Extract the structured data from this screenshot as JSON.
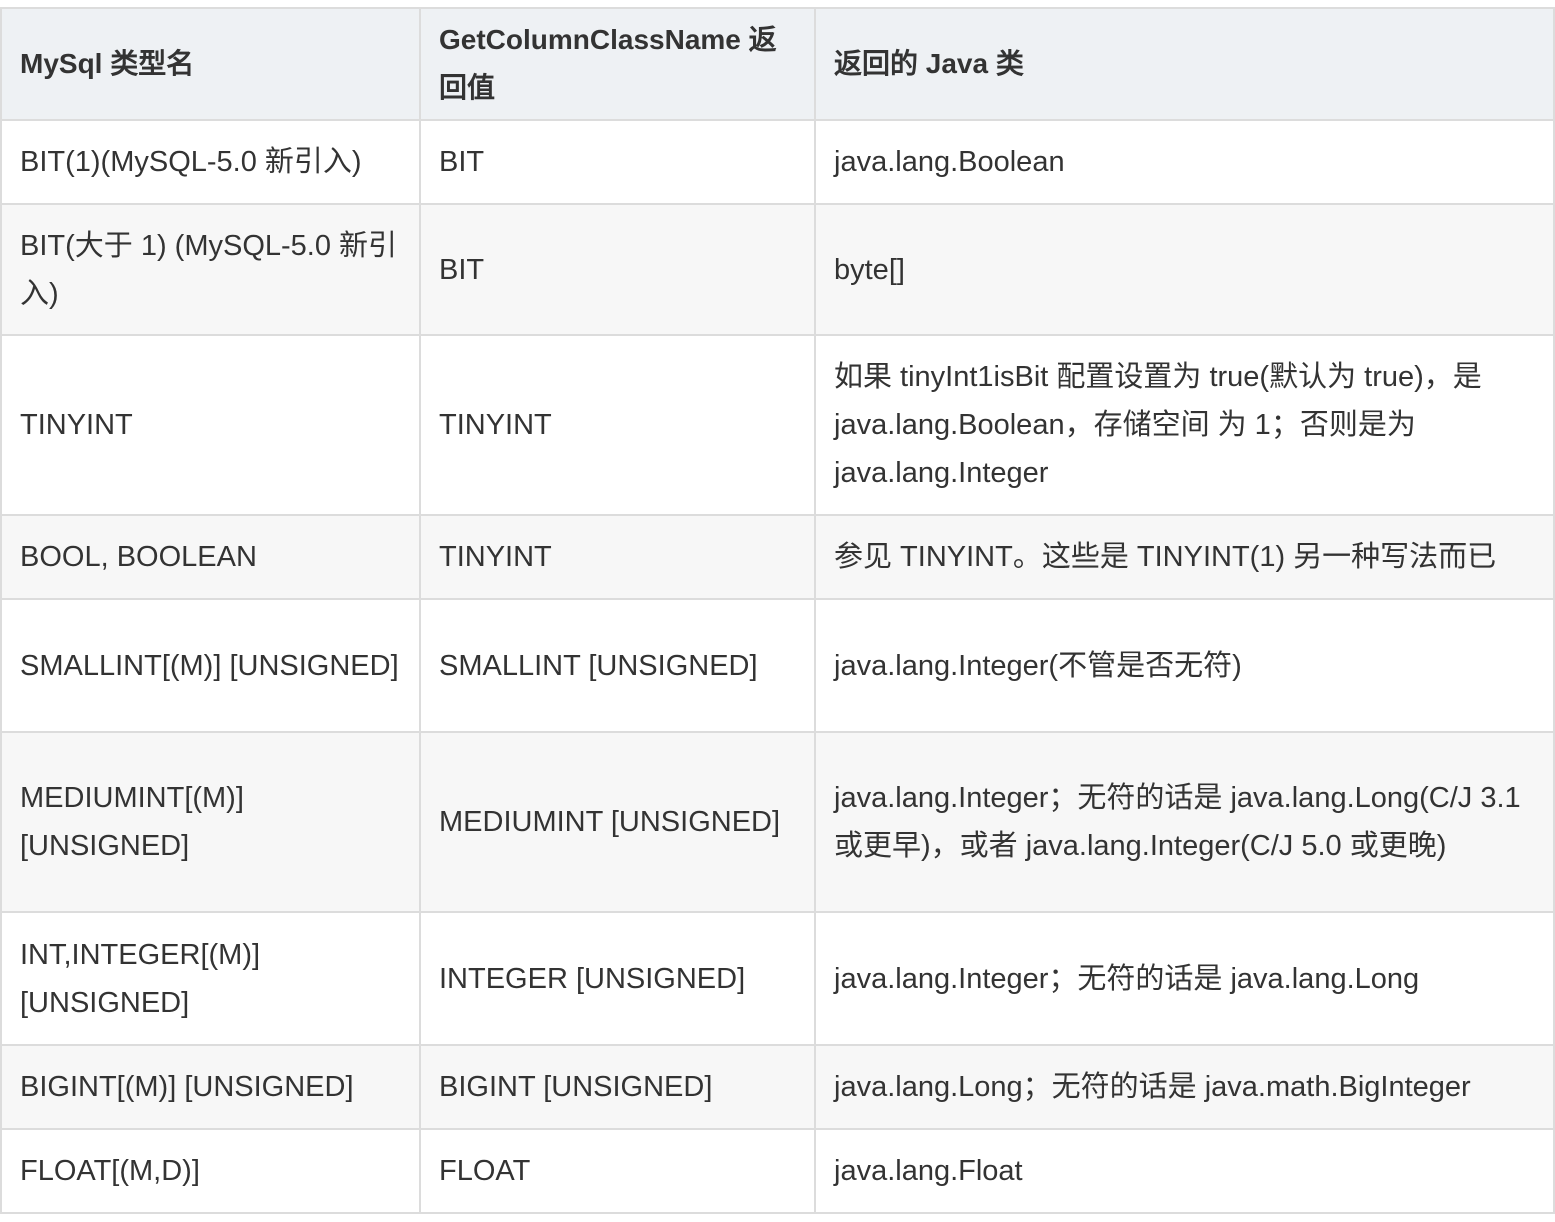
{
  "table": {
    "headers": [
      "MySql 类型名",
      "GetColumnClassName 返回值",
      "返回的 Java 类"
    ],
    "rows": [
      [
        "BIT(1)(MySQL-5.0 新引入)",
        "BIT",
        "java.lang.Boolean"
      ],
      [
        "BIT(大于 1) (MySQL-5.0 新引入)",
        "BIT",
        "byte[]"
      ],
      [
        "TINYINT",
        "TINYINT",
        "如果 tinyInt1isBit 配置设置为 true(默认为 true)，是 java.lang.Boolean，存储空间 为 1；否则是为 java.lang.Integer"
      ],
      [
        "BOOL, BOOLEAN",
        "TINYINT",
        "参见 TINYINT。这些是 TINYINT(1) 另一种写法而已"
      ],
      [
        "SMALLINT[(M)] [UNSIGNED]",
        "SMALLINT [UNSIGNED]",
        "java.lang.Integer(不管是否无符)"
      ],
      [
        "MEDIUMINT[(M)] [UNSIGNED]",
        "MEDIUMINT [UNSIGNED]",
        "java.lang.Integer；无符的话是 java.lang.Long(C/J 3.1 或更早)，或者 java.lang.Integer(C/J 5.0 或更晚)"
      ],
      [
        "INT,INTEGER[(M)] [UNSIGNED]",
        "INTEGER [UNSIGNED]",
        "java.lang.Integer；无符的话是 java.lang.Long"
      ],
      [
        "BIGINT[(M)] [UNSIGNED]",
        "BIGINT [UNSIGNED]",
        "java.lang.Long；无符的话是 java.math.BigInteger"
      ],
      [
        "FLOAT[(M,D)]",
        "FLOAT",
        "java.lang.Float"
      ]
    ]
  },
  "colors": {
    "header_bg": "#eef1f4",
    "stripe_bg": "#f7f7f7",
    "border": "#dcdcdc",
    "text": "#333333"
  }
}
